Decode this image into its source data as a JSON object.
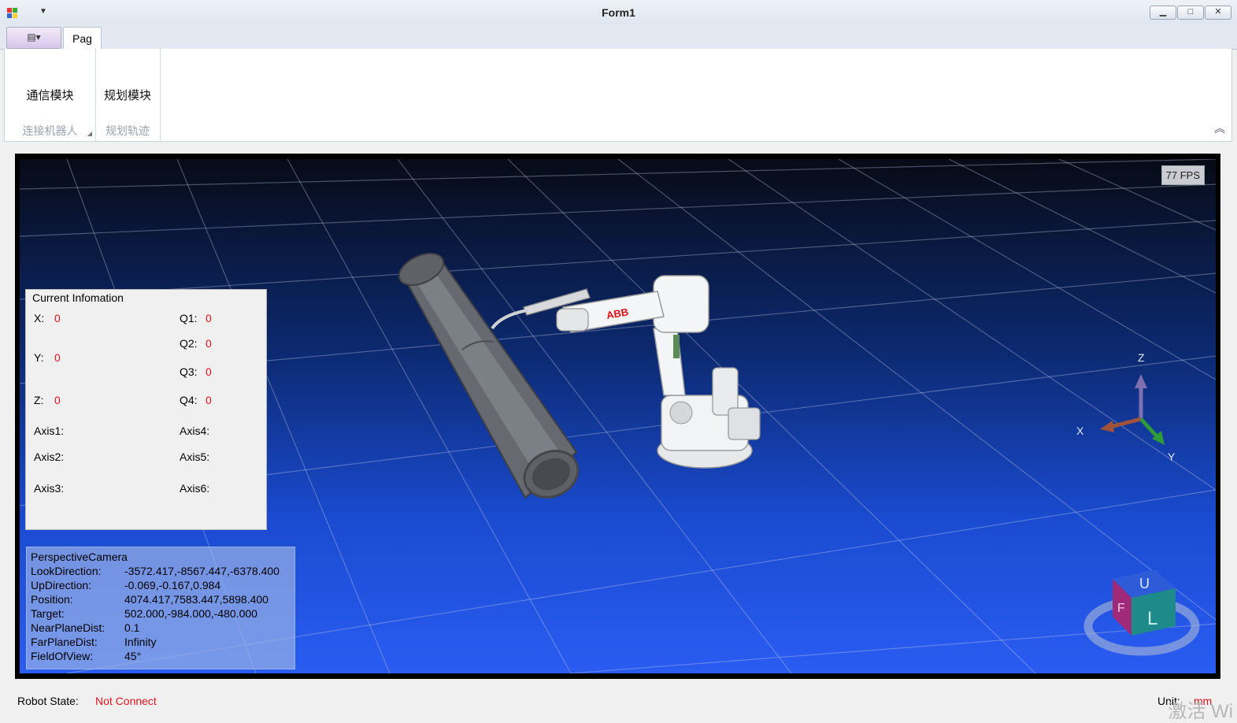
{
  "window": {
    "title": "Form1",
    "minimize": "▁",
    "maximize": "□",
    "close": "✕"
  },
  "ribbon": {
    "tab": "Pag",
    "groups": [
      {
        "button": "通信模块",
        "label": "连接机器人"
      },
      {
        "button": "规划模块",
        "label": "规划轨迹"
      }
    ],
    "collapse_icon": "chevron-up-icon"
  },
  "viewport": {
    "fps": "77 FPS",
    "current_info": {
      "title": "Current Infomation",
      "x_label": "X:",
      "x_value": "0",
      "y_label": "Y:",
      "y_value": "0",
      "z_label": "Z:",
      "z_value": "0",
      "q1_label": "Q1:",
      "q1_value": "0",
      "q2_label": "Q2:",
      "q2_value": "0",
      "q3_label": "Q3:",
      "q3_value": "0",
      "q4_label": "Q4:",
      "q4_value": "0",
      "axis1": "Axis1:",
      "axis2": "Axis2:",
      "axis3": "Axis3:",
      "axis4": "Axis4:",
      "axis5": "Axis5:",
      "axis6": "Axis6:"
    },
    "camera": {
      "title": "PerspectiveCamera",
      "rows": [
        {
          "label": "LookDirection:",
          "value": "-3572.417,-8567.447,-6378.400"
        },
        {
          "label": "UpDirection:",
          "value": "-0.069,-0.167,0.984"
        },
        {
          "label": "Position:",
          "value": "4074.417,7583.447,5898.400"
        },
        {
          "label": "Target:",
          "value": "502.000,-984.000,-480.000"
        },
        {
          "label": "NearPlaneDist:",
          "value": "0.1"
        },
        {
          "label": "FarPlaneDist:",
          "value": "Infinity"
        },
        {
          "label": "FieldOfView:",
          "value": "45°"
        }
      ]
    },
    "coordinate_axes": {
      "z": "Z",
      "x": "X",
      "y": "Y"
    },
    "robot_logo": "ABB",
    "view_cube": {
      "top": "U",
      "front": "F",
      "right": "L"
    }
  },
  "status": {
    "robot_state_label": "Robot State:",
    "robot_state_value": "Not Connect",
    "unit_label": "Unit:",
    "unit_value": "mm",
    "watermark": "激活 Wi"
  },
  "colors": {
    "status_red": "#e0141e",
    "viewport_top": "#070b16",
    "viewport_bottom": "#2a5cf2"
  }
}
